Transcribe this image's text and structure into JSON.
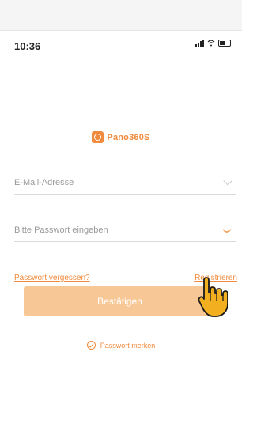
{
  "status_bar": {
    "time": "10:36",
    "signal_icon": "signal-icon",
    "wifi_icon": "wifi-icon",
    "battery_icon": "battery-icon"
  },
  "brand": {
    "logo_text": "Pano360S",
    "accent": "#f08a3c"
  },
  "form": {
    "email_placeholder": "E-Mail-Adresse",
    "password_placeholder": "Bitte Passwort eingeben",
    "forgot_label": "Passwort vergessen?",
    "register_label": "Registrieren",
    "submit_label": "Bestätigen",
    "remember_label": "Passwort merken"
  },
  "colors": {
    "button_bg": "#f7c896",
    "link": "#f08a3c"
  }
}
